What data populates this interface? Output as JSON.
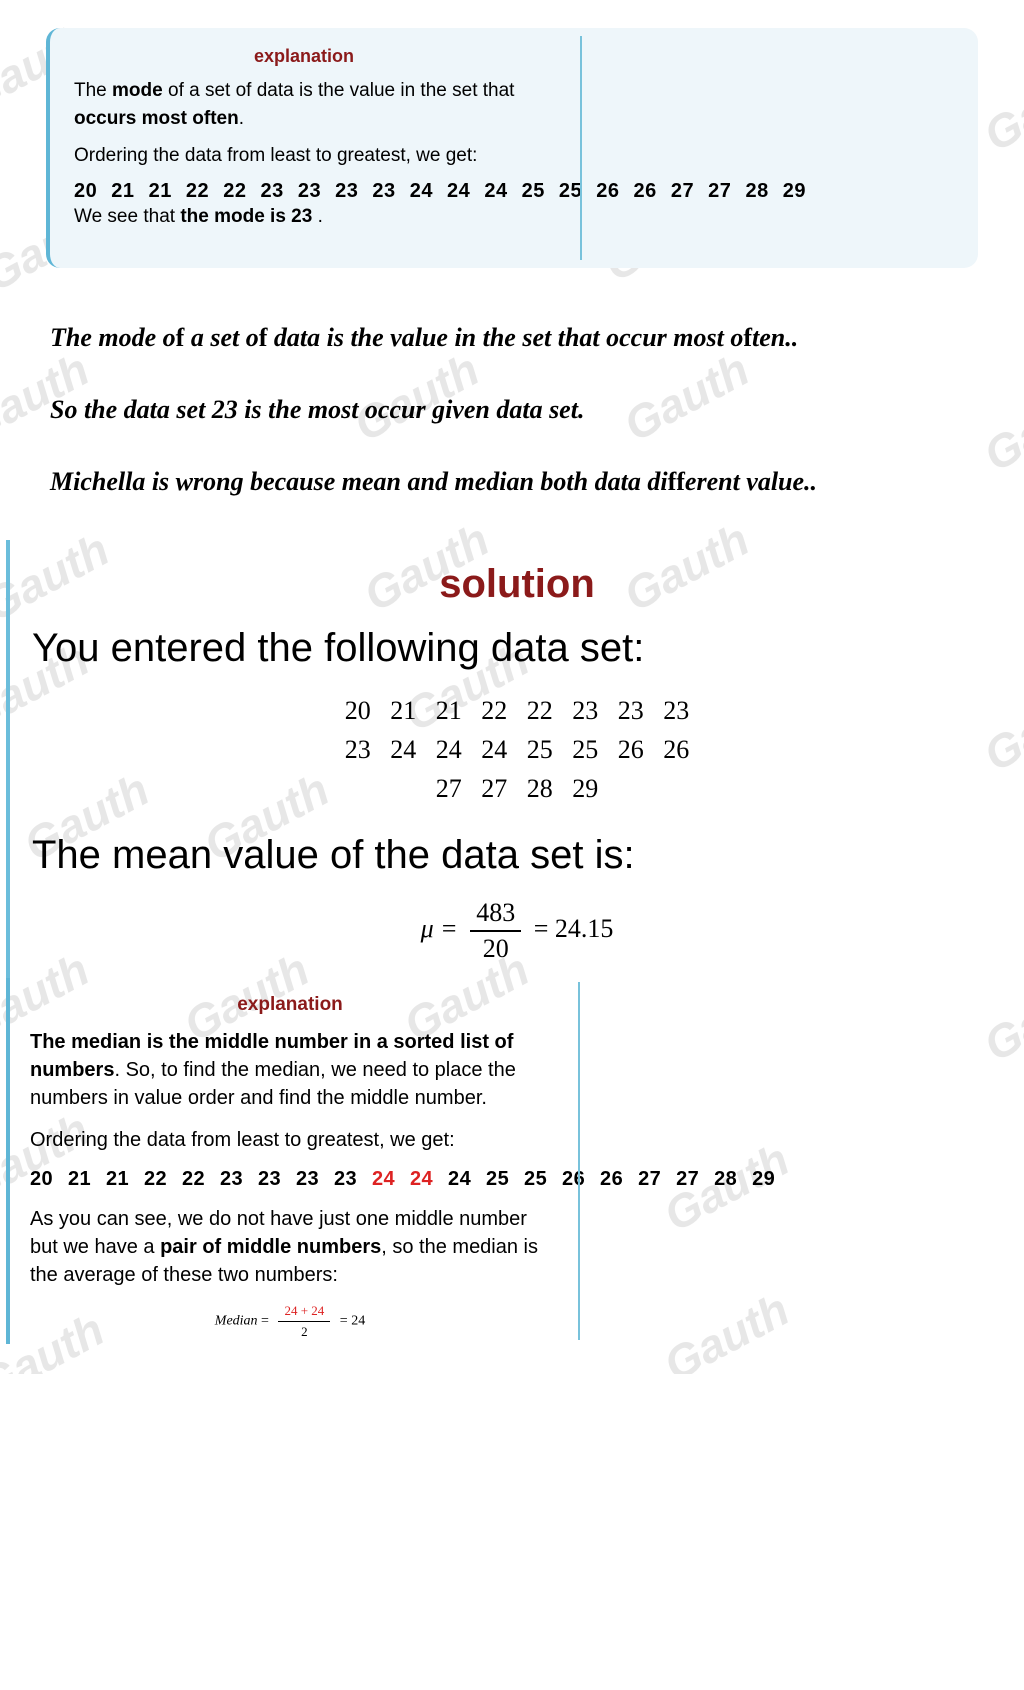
{
  "box1": {
    "title": "explanation",
    "line1_a": "The ",
    "line1_b": "mode",
    "line1_c": " of a set of data is the value in the set that ",
    "line1_d": "occurs most often",
    "line1_e": ".",
    "line2": "Ordering the data from least to greatest, we get:",
    "seq": "20  21  21  22  22  23  23  23  23  24  24  24  25  25  26  26  27  27  28  29",
    "line3_a": "We see that ",
    "line3_b": "the mode is 23",
    "line3_c": " ."
  },
  "mid": {
    "p1a": "The mode o",
    "p1f1": "f",
    "p1b": " a set o",
    "p1f2": "f",
    "p1c": " data is the value in the set that occur most o",
    "p1f3": "f",
    "p1d": "ten..",
    "p2": "So the data set 23 is the most occur given data set.",
    "p3a": "Michella is wrong because mean and median both data di",
    "p3f1": "f",
    "p3f2": "f",
    "p3b": "erent value.."
  },
  "sol": {
    "title": "solution",
    "entered": "You entered the following data set:",
    "row1": "20   21   21   22   22   23   23   23",
    "row2": "23   24   24   24   25   25   26   26",
    "row3": "27   27   28   29",
    "mean_text": "The mean value of the data set is:",
    "mu": "μ =",
    "num": "483",
    "den": "20",
    "eq": "= 24.15"
  },
  "box3": {
    "title": "explanation",
    "p1_a": "The median is the middle number in a sorted list of numbers",
    "p1_b": ". So, to find the median, we need to place the numbers in value order and find the middle number.",
    "p2": "Ordering the data from least to greatest, we get:",
    "seq_a": "20  21  21  22  22  23  23  23  23  ",
    "seq_hl": "24  24",
    "seq_b": "  24  25  25  26  26  27  27  28  29",
    "p3_a": "As you can see, we do not have just one middle number but we have a ",
    "p3_b": "pair of middle numbers",
    "p3_c": ", so the median is the average of these two numbers:",
    "med_lbl": "Median",
    "med_eq1": " = ",
    "med_num": "24 + 24",
    "med_den": "2",
    "med_eq2": " = 24"
  },
  "watermark": "Gauth",
  "chart_data": {
    "type": "table",
    "data_set": [
      20,
      21,
      21,
      22,
      22,
      23,
      23,
      23,
      23,
      24,
      24,
      24,
      25,
      25,
      26,
      26,
      27,
      27,
      28,
      29
    ],
    "n": 20,
    "sum": 483,
    "mean": 24.15,
    "median": 24,
    "mode": 23,
    "middle_pair": [
      24,
      24
    ]
  }
}
